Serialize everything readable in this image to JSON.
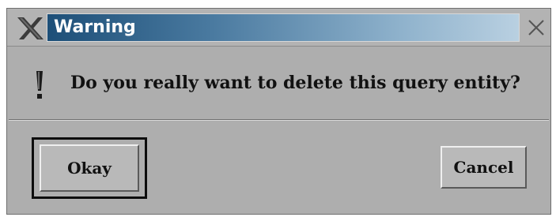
{
  "window": {
    "title": "Warning",
    "message": "Do you really want to delete this query entity?"
  },
  "icons": {
    "menu": "x-logo-icon",
    "close": "close-icon",
    "message": "exclamation-icon"
  },
  "buttons": {
    "okay_label": "Okay",
    "cancel_label": "Cancel",
    "default": "Okay"
  },
  "colors": {
    "titlebar_start": "#1d4f78",
    "titlebar_end": "#b9d0e1",
    "background": "#aeaeae",
    "title_text": "#ffffff"
  }
}
